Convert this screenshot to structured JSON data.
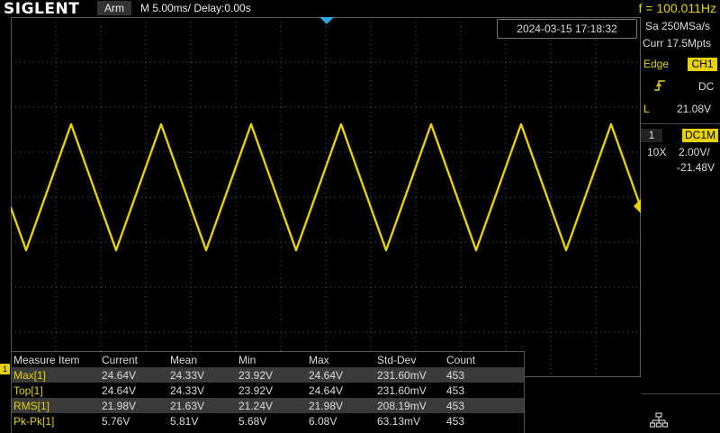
{
  "header": {
    "logo": "SIGLENT",
    "trigger_status": "Arm",
    "timebase": "M 5.00ms/ Delay:0.00s",
    "frequency": "f = 100.011Hz"
  },
  "timestamp": "2024-03-15 17:18:32",
  "acquisition": {
    "sample_rate": "Sa 250MSa/s",
    "memory_depth": "Curr 17.5Mpts"
  },
  "trigger": {
    "type_label": "Edge",
    "source": "CH1",
    "coupling": "DC",
    "level_prefix": "L",
    "level": "21.08V"
  },
  "channel": {
    "number": "1",
    "coupling": "DC1M",
    "probe": "10X",
    "scale": "2.00V/",
    "offset": "-21.48V",
    "marker": "1"
  },
  "measure": {
    "headers": [
      "Measure Item",
      "Current",
      "Mean",
      "Min",
      "Max",
      "Std-Dev",
      "Count"
    ],
    "rows": [
      {
        "item": "Max[1]",
        "current": "24.64V",
        "mean": "24.33V",
        "min": "23.92V",
        "max": "24.64V",
        "stddev": "231.60mV",
        "count": "453"
      },
      {
        "item": "Top[1]",
        "current": "24.64V",
        "mean": "24.33V",
        "min": "23.92V",
        "max": "24.64V",
        "stddev": "231.60mV",
        "count": "453"
      },
      {
        "item": "RMS[1]",
        "current": "21.98V",
        "mean": "21.63V",
        "min": "21.24V",
        "max": "21.98V",
        "stddev": "208.19mV",
        "count": "453"
      },
      {
        "item": "Pk-Pk[1]",
        "current": "5.76V",
        "mean": "5.81V",
        "min": "5.68V",
        "max": "6.08V",
        "stddev": "63.13mV",
        "count": "453"
      }
    ]
  },
  "colors": {
    "trace": "#e6d200",
    "grid": "#5a5a5a",
    "background": "#000000"
  },
  "icons": {
    "network": "network-icon",
    "trigger_edge": "rising-edge-icon"
  }
}
